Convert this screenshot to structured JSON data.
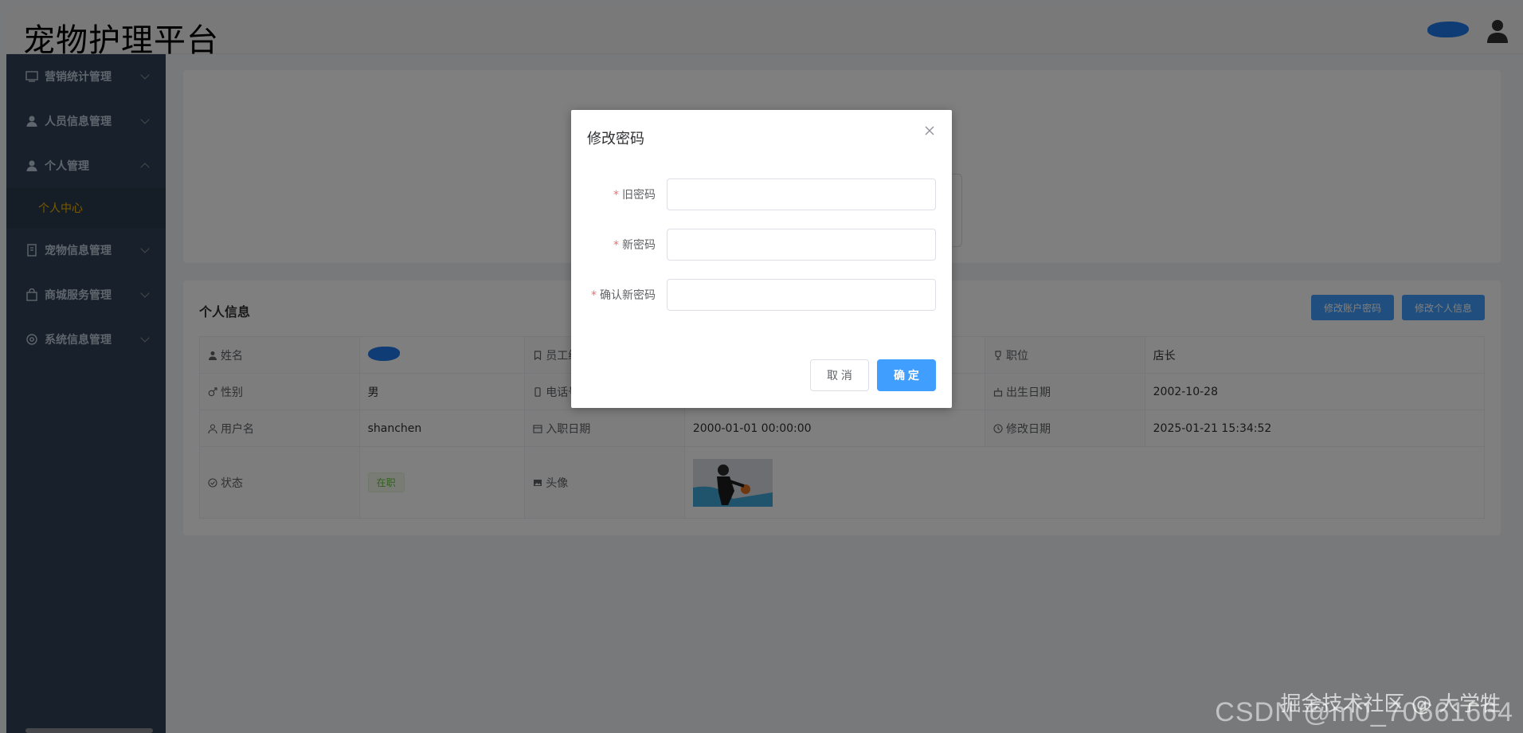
{
  "header": {
    "title": "宠物护理平台"
  },
  "sidebar": {
    "items": [
      {
        "label": "营销统计管理",
        "icon": "chart-icon"
      },
      {
        "label": "人员信息管理",
        "icon": "user-icon"
      },
      {
        "label": "个人管理",
        "icon": "user-icon"
      },
      {
        "label": "宠物信息管理",
        "icon": "document-icon"
      },
      {
        "label": "商城服务管理",
        "icon": "bag-icon"
      },
      {
        "label": "系统信息管理",
        "icon": "gear-icon"
      }
    ],
    "sub_item": "个人中心"
  },
  "welcome": {
    "text": "!"
  },
  "info": {
    "title": "个人信息",
    "btn_change_password": "修改账户密码",
    "btn_edit_info": "修改个人信息",
    "rows": [
      {
        "l1": "姓名",
        "v1": "",
        "l2": "员工编号",
        "v2": "",
        "l3": "职位",
        "v3": "店长"
      },
      {
        "l1": "性别",
        "v1": "男",
        "l2": "电话号码",
        "v2": "",
        "l3": "出生日期",
        "v3": "2002-10-28"
      },
      {
        "l1": "用户名",
        "v1": "shanchen",
        "l2": "入职日期",
        "v2": "2000-01-01 00:00:00",
        "l3": "修改日期",
        "v3": "2025-01-21 15:34:52"
      },
      {
        "l1": "状态",
        "v1": "在职",
        "l2": "头像",
        "v2": ""
      }
    ]
  },
  "dialog": {
    "title": "修改密码",
    "fields": [
      {
        "label": "旧密码",
        "value": ""
      },
      {
        "label": "新密码",
        "value": ""
      },
      {
        "label": "确认新密码",
        "value": ""
      }
    ],
    "cancel": "取 消",
    "confirm": "确 定"
  },
  "watermark": {
    "text": "CSDN @m0_70661664",
    "text2": "掘金技术社区 @ 大学牲"
  },
  "colors": {
    "primary": "#409eff",
    "sidebar": "#304156",
    "active": "#f7b500",
    "required": "#f56c6c",
    "success": "#67c23a"
  }
}
